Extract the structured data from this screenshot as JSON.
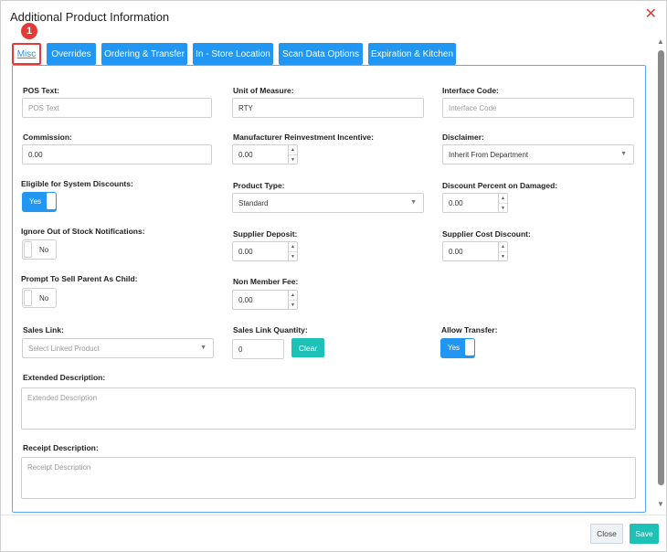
{
  "dialog": {
    "title": "Additional Product Information",
    "close_glyph": "✕",
    "badge": "1"
  },
  "tabs": [
    {
      "label": "Misc",
      "active": true
    },
    {
      "label": "Overrides",
      "active": false
    },
    {
      "label": "Ordering & Transfer",
      "active": false
    },
    {
      "label": "In - Store Location",
      "active": false
    },
    {
      "label": "Scan Data Options",
      "active": false
    },
    {
      "label": "Expiration & Kitchen",
      "active": false
    }
  ],
  "fields": {
    "pos_text": {
      "label": "POS Text:",
      "placeholder": "POS Text"
    },
    "unit_of_measure": {
      "label": "Unit of Measure:",
      "value": "RTY"
    },
    "interface_code": {
      "label": "Interface Code:",
      "placeholder": "Interface Code"
    },
    "commission": {
      "label": "Commission:",
      "value": "0.00"
    },
    "manufacturer_reinvestment": {
      "label": "Manufacturer Reinvestment Incentive:",
      "value": "0.00"
    },
    "disclaimer": {
      "label": "Disclaimer:",
      "value": "Inherit From Department"
    },
    "eligible_discounts": {
      "label": "Eligible for System Discounts:",
      "value": "Yes"
    },
    "product_type": {
      "label": "Product Type:",
      "value": "Standard"
    },
    "discount_damaged": {
      "label": "Discount Percent on Damaged:",
      "value": "0.00"
    },
    "ignore_out_of_stock": {
      "label": "Ignore Out of Stock Notifications:",
      "value": "No"
    },
    "supplier_deposit": {
      "label": "Supplier Deposit:",
      "value": "0.00"
    },
    "supplier_cost_discount": {
      "label": "Supplier Cost Discount:",
      "value": "0.00"
    },
    "prompt_sell_parent": {
      "label": "Prompt To Sell Parent As Child:",
      "value": "No"
    },
    "non_member_fee": {
      "label": "Non Member Fee:",
      "value": "0.00"
    },
    "sales_link": {
      "label": "Sales Link:",
      "placeholder": "Select Linked Product"
    },
    "sales_link_quantity": {
      "label": "Sales Link Quantity:",
      "value": "0",
      "clear_label": "Clear"
    },
    "allow_transfer": {
      "label": "Allow Transfer:",
      "value": "Yes"
    },
    "extended_description": {
      "label": "Extended Description:",
      "placeholder": "Extended Description"
    },
    "receipt_description": {
      "label": "Receipt Description:",
      "placeholder": "Receipt Description"
    }
  },
  "footer": {
    "close_label": "Close",
    "save_label": "Save"
  },
  "colors": {
    "primary": "#2196f3",
    "accent": "#1ec1b6",
    "danger": "#e53935"
  }
}
